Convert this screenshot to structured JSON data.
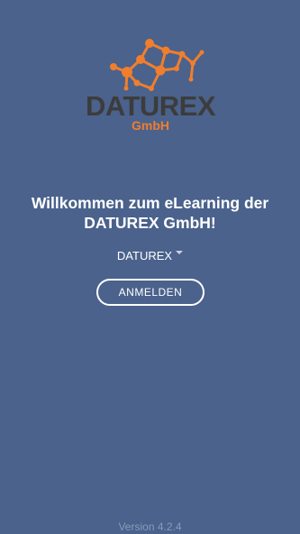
{
  "logo": {
    "brand_name": "DATUREX",
    "brand_suffix": "GmbH",
    "brand_color": "#3c3c3c",
    "accent_color": "#f07e2d",
    "icon": "network-molecule-icon"
  },
  "welcome": {
    "line1": "Willkommen zum eLearning der",
    "line2": "DATUREX GmbH!"
  },
  "tenant_selector": {
    "selected": "DATUREX",
    "icon": "dropdown-caret-icon"
  },
  "login_button": {
    "label": "ANMELDEN"
  },
  "footer": {
    "version": "Version 4.2.4"
  },
  "colors": {
    "background": "#4a628c",
    "text": "#ffffff",
    "version_text": "#8a9bb8"
  }
}
